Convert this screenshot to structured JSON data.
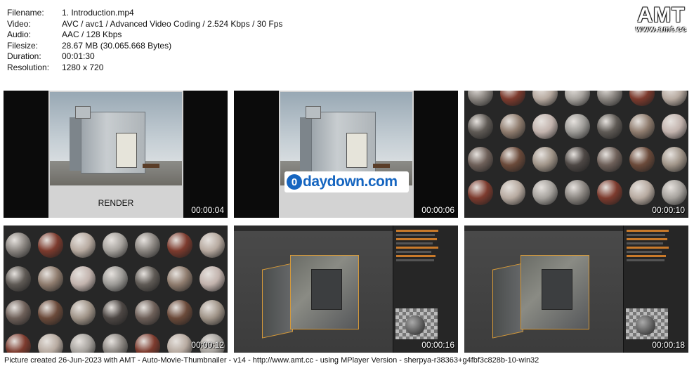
{
  "meta": {
    "rows": [
      {
        "key": "Filename:",
        "value": "1. Introduction.mp4"
      },
      {
        "key": "Video:",
        "value": "AVC / avc1 / Advanced Video Coding / 2.524 Kbps / 30 Fps"
      },
      {
        "key": "Audio:",
        "value": "AAC / 128 Kbps"
      },
      {
        "key": "Filesize:",
        "value": "28.67 MB (30.065.668 Bytes)"
      },
      {
        "key": "Duration:",
        "value": "00:01:30"
      },
      {
        "key": "Resolution:",
        "value": "1280 x 720"
      }
    ]
  },
  "logo": {
    "big": "AMT",
    "small": "www.amt.cc"
  },
  "thumbs": [
    {
      "timestamp": "00:00:04",
      "kind": "render",
      "label": "RENDER"
    },
    {
      "timestamp": "00:00:06",
      "kind": "render-promo",
      "promo": "daydown.com"
    },
    {
      "timestamp": "00:00:10",
      "kind": "materials"
    },
    {
      "timestamp": "00:00:12",
      "kind": "materials"
    },
    {
      "timestamp": "00:00:16",
      "kind": "blender"
    },
    {
      "timestamp": "00:00:18",
      "kind": "blender"
    }
  ],
  "footer": "Picture created 26-Jun-2023 with AMT - Auto-Movie-Thumbnailer - v14 - http://www.amt.cc - using MPlayer Version - sherpya-r38363+g4fbf3c828b-10-win32",
  "colors": {
    "background": "#ffffff",
    "frame": "#0b0b0b",
    "promo_blue": "#1565c0",
    "blender_accent": "#d69a3a"
  }
}
